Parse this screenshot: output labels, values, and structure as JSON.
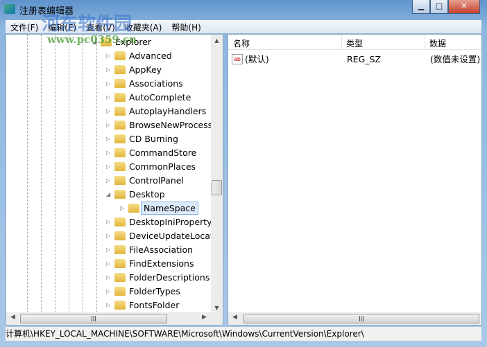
{
  "window": {
    "title": "注册表编辑器",
    "minimize": "▁",
    "maximize": "□",
    "close": "✕"
  },
  "menu": [
    "文件(F)",
    "编辑(E)",
    "查看(V)",
    "收藏夹(A)",
    "帮助(H)"
  ],
  "watermark": {
    "name": "河东软件园",
    "url": "www.pc0359.cn"
  },
  "tree": {
    "parent": "Explorer",
    "items": [
      {
        "label": "Advanced"
      },
      {
        "label": "AppKey"
      },
      {
        "label": "Associations"
      },
      {
        "label": "AutoComplete"
      },
      {
        "label": "AutoplayHandlers"
      },
      {
        "label": "BrowseNewProcess"
      },
      {
        "label": "CD Burning"
      },
      {
        "label": "CommandStore"
      },
      {
        "label": "CommonPlaces"
      },
      {
        "label": "ControlPanel"
      },
      {
        "label": "Desktop",
        "expanded": true
      },
      {
        "label": "NameSpace",
        "child": true,
        "selected": true
      },
      {
        "label": "DesktopIniPropertyMap"
      },
      {
        "label": "DeviceUpdateLocations"
      },
      {
        "label": "FileAssociation"
      },
      {
        "label": "FindExtensions"
      },
      {
        "label": "FolderDescriptions"
      },
      {
        "label": "FolderTypes"
      },
      {
        "label": "FontsFolder"
      }
    ]
  },
  "list": {
    "columns": [
      "名称",
      "类型",
      "数据"
    ],
    "rows": [
      {
        "name": "(默认)",
        "type": "REG_SZ",
        "data": "(数值未设置)",
        "icon": "ab"
      }
    ]
  },
  "status": "计算机\\HKEY_LOCAL_MACHINE\\SOFTWARE\\Microsoft\\Windows\\CurrentVersion\\Explorer\\"
}
